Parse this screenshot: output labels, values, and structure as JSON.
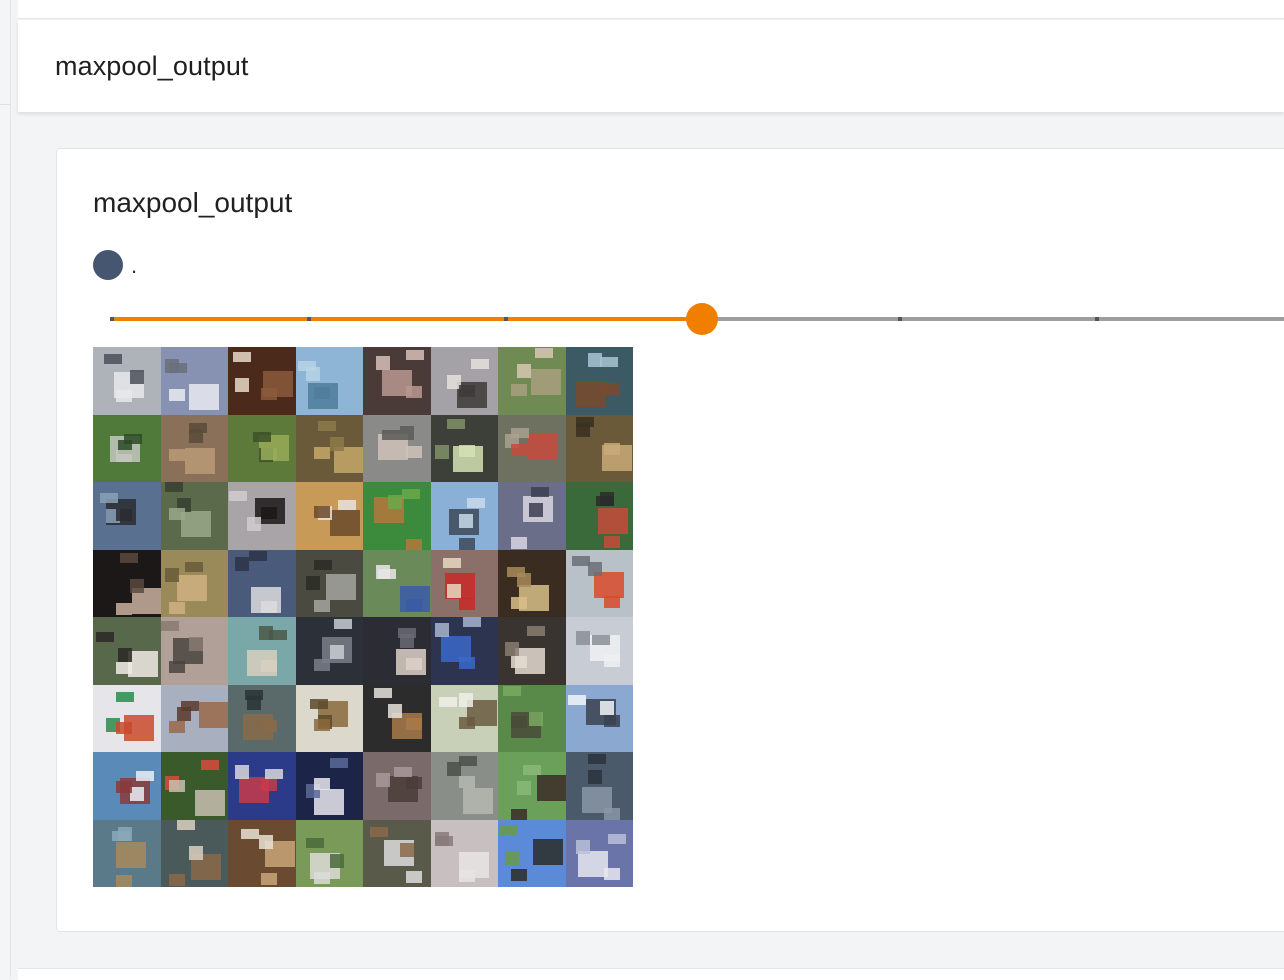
{
  "section": {
    "title": "maxpool_output"
  },
  "card": {
    "title": "maxpool_output",
    "run_label": ".",
    "run_color": "#465670"
  },
  "slider": {
    "accent": "#f07f00",
    "track_color": "#9e9e9e",
    "step_count": 7,
    "current_step_index": 3,
    "value_fraction": 0.5
  },
  "image_grid": {
    "rows": 8,
    "columns": 8,
    "alt": "8×8 grid of blurry pixelated thumbnail images",
    "cells": [
      {
        "bg": "#aeb3ba",
        "fg": "#e6e8ea",
        "accent": "#4a4f5a"
      },
      {
        "bg": "#8792b2",
        "fg": "#e9eaf0",
        "accent": "#6b6f7c"
      },
      {
        "bg": "#4b2a1c",
        "fg": "#8a5a3c",
        "accent": "#e8d8c8"
      },
      {
        "bg": "#8fb5d6",
        "fg": "#4f7d9b",
        "accent": "#b8d2e6"
      },
      {
        "bg": "#4a3a38",
        "fg": "#b89890",
        "accent": "#d8c0b8"
      },
      {
        "bg": "#a4a2a6",
        "fg": "#3e3a38",
        "accent": "#e4e0dc"
      },
      {
        "bg": "#6f8a52",
        "fg": "#a99f7f",
        "accent": "#d8c8b0"
      },
      {
        "bg": "#3c5a64",
        "fg": "#7a4a2c",
        "accent": "#a6c4d2"
      },
      {
        "bg": "#4f7a3a",
        "fg": "#c4c8c0",
        "accent": "#2c4a24"
      },
      {
        "bg": "#8a7058",
        "fg": "#b89a78",
        "accent": "#5a4a3a"
      },
      {
        "bg": "#5e7a3a",
        "fg": "#98ac58",
        "accent": "#3c5028"
      },
      {
        "bg": "#6a5a3a",
        "fg": "#c4a868",
        "accent": "#8a7a4a"
      },
      {
        "bg": "#8a8a88",
        "fg": "#cfc2b8",
        "accent": "#5a5a58"
      },
      {
        "bg": "#3c4038",
        "fg": "#d4e2b4",
        "accent": "#80906a"
      },
      {
        "bg": "#6e7060",
        "fg": "#c84a3c",
        "accent": "#a8a090"
      },
      {
        "bg": "#6a5a3a",
        "fg": "#c8aa78",
        "accent": "#3a3020"
      },
      {
        "bg": "#5a7090",
        "fg": "#2c2c30",
        "accent": "#8aa0b8"
      },
      {
        "bg": "#5a6a4a",
        "fg": "#9aa88a",
        "accent": "#384030"
      },
      {
        "bg": "#a8a4a8",
        "fg": "#1c1818",
        "accent": "#d0ccd0"
      },
      {
        "bg": "#c89a58",
        "fg": "#6a4a2c",
        "accent": "#e6e2dc"
      },
      {
        "bg": "#3c8a3c",
        "fg": "#b4783c",
        "accent": "#6aa84a"
      },
      {
        "bg": "#8ab0d8",
        "fg": "#3c4a58",
        "accent": "#c8daea"
      },
      {
        "bg": "#6a6e88",
        "fg": "#d8d6e0",
        "accent": "#3c3e50"
      },
      {
        "bg": "#3a6a3a",
        "fg": "#c84a3c",
        "accent": "#2c2c2c"
      },
      {
        "bg": "#1c1818",
        "fg": "#c8b0a0",
        "accent": "#5a4a40"
      },
      {
        "bg": "#9a8a5a",
        "fg": "#d0b080",
        "accent": "#6a5a3a"
      },
      {
        "bg": "#4a5a7a",
        "fg": "#dcdcde",
        "accent": "#2c3448"
      },
      {
        "bg": "#4a4a40",
        "fg": "#a4a4a0",
        "accent": "#2c2c28"
      },
      {
        "bg": "#6a8a5a",
        "fg": "#3a5aa8",
        "accent": "#e6e6e6"
      },
      {
        "bg": "#8a7068",
        "fg": "#c82828",
        "accent": "#e8d8c0"
      },
      {
        "bg": "#3a2c20",
        "fg": "#d8c088",
        "accent": "#a88a5a"
      },
      {
        "bg": "#b8c0c8",
        "fg": "#d84a2c",
        "accent": "#6a6e74"
      },
      {
        "bg": "#58684a",
        "fg": "#eeeae4",
        "accent": "#2c2824"
      },
      {
        "bg": "#b0a098",
        "fg": "#4a4440",
        "accent": "#8a7a70"
      },
      {
        "bg": "#7aa8a8",
        "fg": "#d8d0c0",
        "accent": "#4a5848"
      },
      {
        "bg": "#2c3038",
        "fg": "#7a7e88",
        "accent": "#c8ccd4"
      },
      {
        "bg": "#2c2c34",
        "fg": "#dcd0c8",
        "accent": "#6a6a74"
      },
      {
        "bg": "#2c3450",
        "fg": "#3a68c8",
        "accent": "#a8b4cc"
      },
      {
        "bg": "#3a3430",
        "fg": "#e4dcd0",
        "accent": "#8a7e70"
      },
      {
        "bg": "#c8ccd4",
        "fg": "#f0f0f2",
        "accent": "#8a8e98"
      },
      {
        "bg": "#e6e6ea",
        "fg": "#c84a2c",
        "accent": "#2c8a4a"
      },
      {
        "bg": "#a8b0c0",
        "fg": "#9a6a4a",
        "accent": "#5a3a2c"
      },
      {
        "bg": "#5a6a6a",
        "fg": "#8a6a4a",
        "accent": "#2c3434"
      },
      {
        "bg": "#dcd8cc",
        "fg": "#8a6a3c",
        "accent": "#5a4a2c"
      },
      {
        "bg": "#2c2c2c",
        "fg": "#a87a4a",
        "accent": "#e6e2dc"
      },
      {
        "bg": "#c8d0b8",
        "fg": "#6a5a40",
        "accent": "#eef0ea"
      },
      {
        "bg": "#5a8a4a",
        "fg": "#4a4a38",
        "accent": "#7aa860"
      },
      {
        "bg": "#8aa8d0",
        "fg": "#3a4250",
        "accent": "#f0f4f8"
      },
      {
        "bg": "#5a8ab8",
        "fg": "#8a3a3a",
        "accent": "#e8eef4"
      },
      {
        "bg": "#3a5a2c",
        "fg": "#c8c0b0",
        "accent": "#d84a3c"
      },
      {
        "bg": "#2c3a8a",
        "fg": "#c83a4a",
        "accent": "#d8d8dc"
      },
      {
        "bg": "#1c2448",
        "fg": "#e8e8ee",
        "accent": "#5a6a9a"
      },
      {
        "bg": "#7a6a6a",
        "fg": "#4a3c38",
        "accent": "#a8989a"
      },
      {
        "bg": "#8a8e88",
        "fg": "#b4b8b0",
        "accent": "#4a5048"
      },
      {
        "bg": "#6aa05a",
        "fg": "#3c2c28",
        "accent": "#8ab878"
      },
      {
        "bg": "#4a5a6a",
        "fg": "#8a96a4",
        "accent": "#2c343c"
      },
      {
        "bg": "#5a7a8a",
        "fg": "#a88a5a",
        "accent": "#8aa8b8"
      },
      {
        "bg": "#4a5a5a",
        "fg": "#8a6a4a",
        "accent": "#d8d0c0"
      },
      {
        "bg": "#6a4a30",
        "fg": "#c8a478",
        "accent": "#e8e0d4"
      },
      {
        "bg": "#7a9a5a",
        "fg": "#dcdcd8",
        "accent": "#4a6a3a"
      },
      {
        "bg": "#5a5a4a",
        "fg": "#dcdcdc",
        "accent": "#8a6a4a"
      },
      {
        "bg": "#c8c0c0",
        "fg": "#e8e4e4",
        "accent": "#8a7a7a"
      },
      {
        "bg": "#5a8ad8",
        "fg": "#2c2c28",
        "accent": "#6a9a4a"
      },
      {
        "bg": "#6a74a8",
        "fg": "#e6e8f0",
        "accent": "#b8c0d8"
      }
    ]
  }
}
